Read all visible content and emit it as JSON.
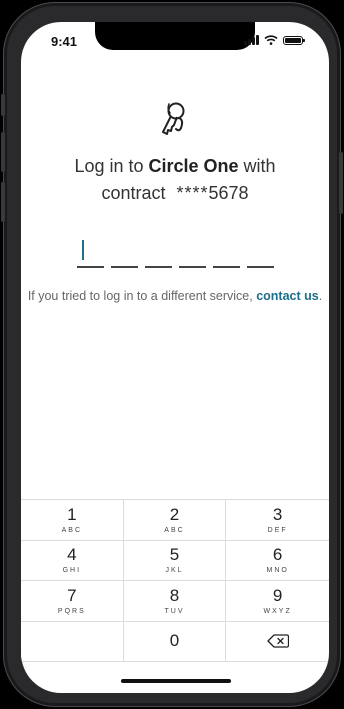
{
  "status_bar": {
    "time": "9:41"
  },
  "login": {
    "title_prefix": "Log in to ",
    "service_name": "Circle One",
    "title_suffix": " with",
    "contract_label": "contract",
    "contract_mask": "****",
    "contract_last4": "5678",
    "pin_length": 6,
    "hint_text": "If you tried to log in to a different service, ",
    "hint_link": "contact us",
    "hint_end": "."
  },
  "keypad": {
    "keys": [
      {
        "num": "1",
        "letters": "ABC"
      },
      {
        "num": "2",
        "letters": "ABC"
      },
      {
        "num": "3",
        "letters": "DEF"
      },
      {
        "num": "4",
        "letters": "GHI"
      },
      {
        "num": "5",
        "letters": "JKL"
      },
      {
        "num": "6",
        "letters": "MNO"
      },
      {
        "num": "7",
        "letters": "PQRS"
      },
      {
        "num": "8",
        "letters": "TUV"
      },
      {
        "num": "9",
        "letters": "WXYZ"
      },
      {
        "num": "",
        "letters": ""
      },
      {
        "num": "0",
        "letters": ""
      }
    ],
    "delete_icon": "backspace-icon"
  }
}
